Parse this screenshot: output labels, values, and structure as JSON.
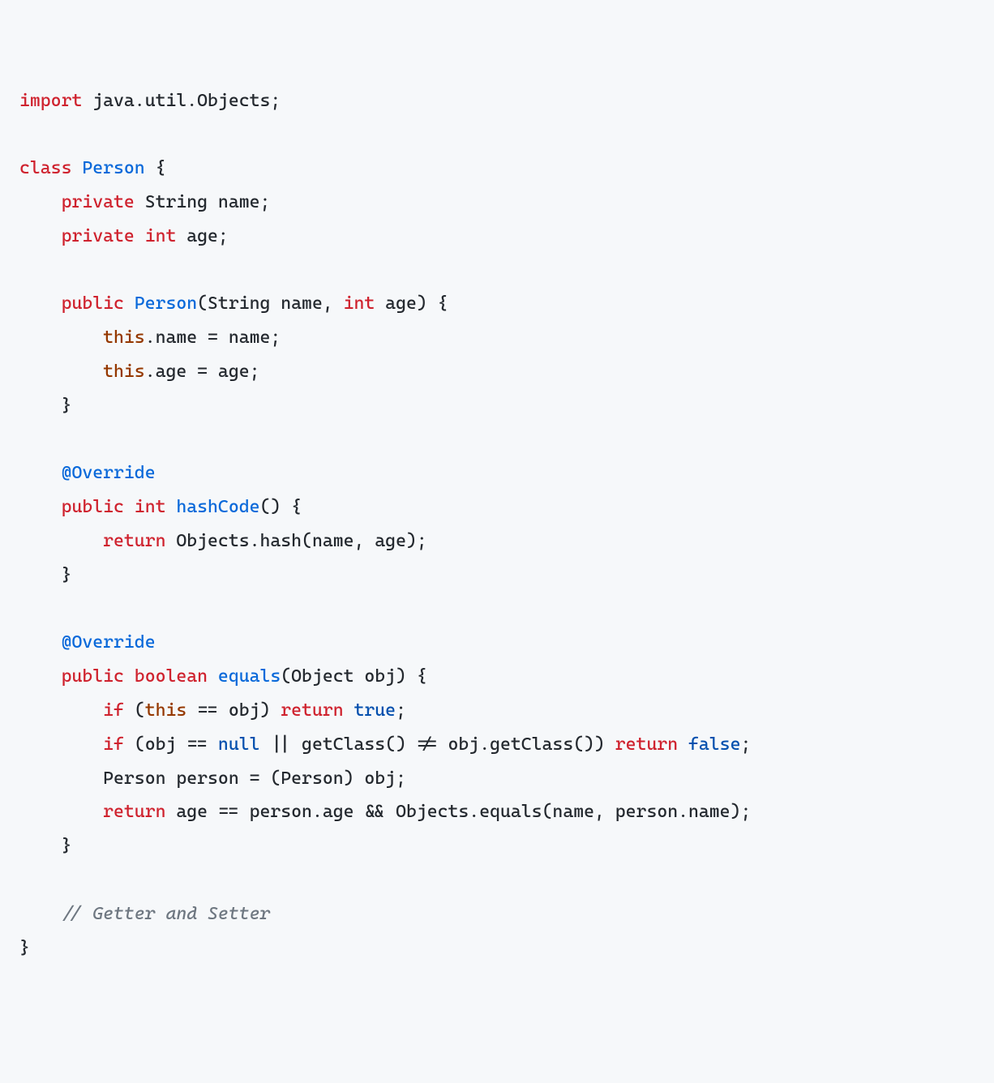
{
  "code": {
    "l1": {
      "kw_import": "import",
      "pkg": " java.util.Objects;"
    },
    "l3": {
      "kw_class": "class",
      "sp1": " ",
      "cls": "Person",
      "rest": " {"
    },
    "l4": {
      "indent": "    ",
      "kw_private": "private",
      "sp": " String name;"
    },
    "l5": {
      "indent": "    ",
      "kw_private": "private",
      "sp1": " ",
      "kw_int": "int",
      "rest": " age;"
    },
    "l7": {
      "indent": "    ",
      "kw_public": "public",
      "sp1": " ",
      "ctor": "Person",
      "sig1": "(String name, ",
      "kw_int": "int",
      "sig2": " age) {"
    },
    "l8": {
      "indent": "        ",
      "kw_this": "this",
      "rest": ".name = name;"
    },
    "l9": {
      "indent": "        ",
      "kw_this": "this",
      "rest": ".age = age;"
    },
    "l10": {
      "indent": "    ",
      "brace": "}"
    },
    "l12": {
      "indent": "    ",
      "anno": "@Override"
    },
    "l13": {
      "indent": "    ",
      "kw_public": "public",
      "sp1": " ",
      "kw_int": "int",
      "sp2": " ",
      "method": "hashCode",
      "rest": "() {"
    },
    "l14": {
      "indent": "        ",
      "kw_return": "return",
      "rest": " Objects.hash(name, age);"
    },
    "l15": {
      "indent": "    ",
      "brace": "}"
    },
    "l17": {
      "indent": "    ",
      "anno": "@Override"
    },
    "l18": {
      "indent": "    ",
      "kw_public": "public",
      "sp1": " ",
      "kw_bool": "boolean",
      "sp2": " ",
      "method": "equals",
      "rest": "(Object obj) {"
    },
    "l19": {
      "indent": "        ",
      "kw_if": "if",
      "p1": " (",
      "kw_this": "this",
      "p2": " == obj) ",
      "kw_return": "return",
      "sp": " ",
      "kw_true": "true",
      "semi": ";"
    },
    "l20": {
      "indent": "        ",
      "kw_if": "if",
      "p1": " (obj == ",
      "kw_null": "null",
      "p2": " || getClass() != obj.getClass()) ",
      "kw_return": "return",
      "sp": " ",
      "kw_false": "false",
      "semi": ";"
    },
    "l21": {
      "indent": "        ",
      "txt": "Person person = (Person) obj;"
    },
    "l22": {
      "indent": "        ",
      "kw_return": "return",
      "rest": " age == person.age && Objects.equals(name, person.name);"
    },
    "l23": {
      "indent": "    ",
      "brace": "}"
    },
    "l25": {
      "indent": "    ",
      "comment": "// Getter and Setter"
    },
    "l26": {
      "brace": "}"
    }
  }
}
